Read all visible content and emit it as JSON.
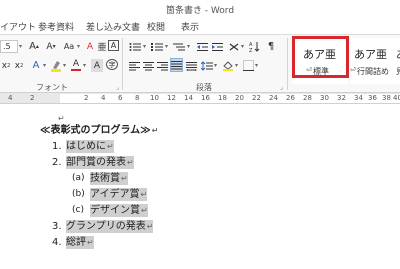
{
  "window": {
    "title": "箇条書き - Word"
  },
  "tabs": [
    "イアウト",
    "参考資料",
    "差し込み文書",
    "校閲",
    "表示"
  ],
  "ribbon": {
    "font_size": ".5",
    "font_group_label": "フォント",
    "paragraph_group_label": "段落",
    "styles": [
      {
        "sample": "あア亜",
        "name": "標準",
        "prefix": "⏎"
      },
      {
        "sample": "あア亜",
        "name": "行間詰め",
        "prefix": "⏎"
      },
      {
        "sample": "あ",
        "name": "見"
      }
    ]
  },
  "ruler": {
    "numbers": [
      "4",
      "2",
      "2",
      "4",
      "6",
      "8",
      "10",
      "12",
      "14",
      "16",
      "18",
      "20",
      "22",
      "24",
      "26",
      "28",
      "30",
      "32",
      "34",
      "36",
      "38",
      "40"
    ]
  },
  "document": {
    "empty_mark": "↵",
    "title": "≪表彰式のプログラム≫",
    "items": [
      {
        "marker": "1.",
        "text": "はじめに"
      },
      {
        "marker": "2.",
        "text": "部門賞の発表"
      },
      {
        "marker": "(a)",
        "text": "技術賞"
      },
      {
        "marker": "(b)",
        "text": "アイデア賞"
      },
      {
        "marker": "(c)",
        "text": "デザイン賞"
      },
      {
        "marker": "3.",
        "text": "グランプリの発表"
      },
      {
        "marker": "4.",
        "text": "総評"
      }
    ],
    "para_mark": "↵"
  },
  "colors": {
    "highlight_border": "#d9262c",
    "selection": "#cfcfcf"
  }
}
